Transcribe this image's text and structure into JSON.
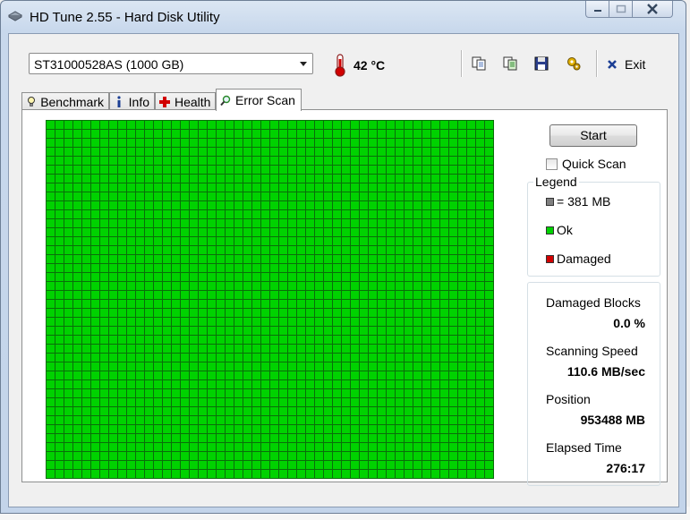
{
  "window": {
    "title": "HD Tune 2.55 - Hard Disk Utility"
  },
  "toolbar": {
    "drive": "ST31000528AS (1000 GB)",
    "temperature": "42 °C",
    "exit_label": "Exit",
    "icons": [
      "copy-icon",
      "copy-all-icon",
      "save-icon",
      "options-icon"
    ]
  },
  "tabs": [
    {
      "label": "Benchmark",
      "icon": "lightbulb-icon"
    },
    {
      "label": "Info",
      "icon": "info-icon"
    },
    {
      "label": "Health",
      "icon": "health-cross-icon"
    },
    {
      "label": "Error Scan",
      "icon": "magnifier-icon",
      "active": true
    }
  ],
  "scan": {
    "start_label": "Start",
    "quick_scan_label": "Quick Scan",
    "quick_scan_checked": false,
    "grid_status": "all blocks ok"
  },
  "legend": {
    "title": "Legend",
    "items": [
      {
        "label": "= 381 MB",
        "color": "#808080"
      },
      {
        "label": "Ok",
        "color": "#00d200"
      },
      {
        "label": "Damaged",
        "color": "#d10000"
      }
    ]
  },
  "stats": {
    "damaged_blocks_label": "Damaged Blocks",
    "damaged_blocks_value": "0.0 %",
    "scanning_speed_label": "Scanning Speed",
    "scanning_speed_value": "110.6 MB/sec",
    "position_label": "Position",
    "position_value": "953488 MB",
    "elapsed_time_label": "Elapsed Time",
    "elapsed_time_value": "276:17"
  },
  "colors": {
    "ok_green": "#00d200",
    "grid_line": "#0a6e0a",
    "accent_red": "#d10000"
  }
}
